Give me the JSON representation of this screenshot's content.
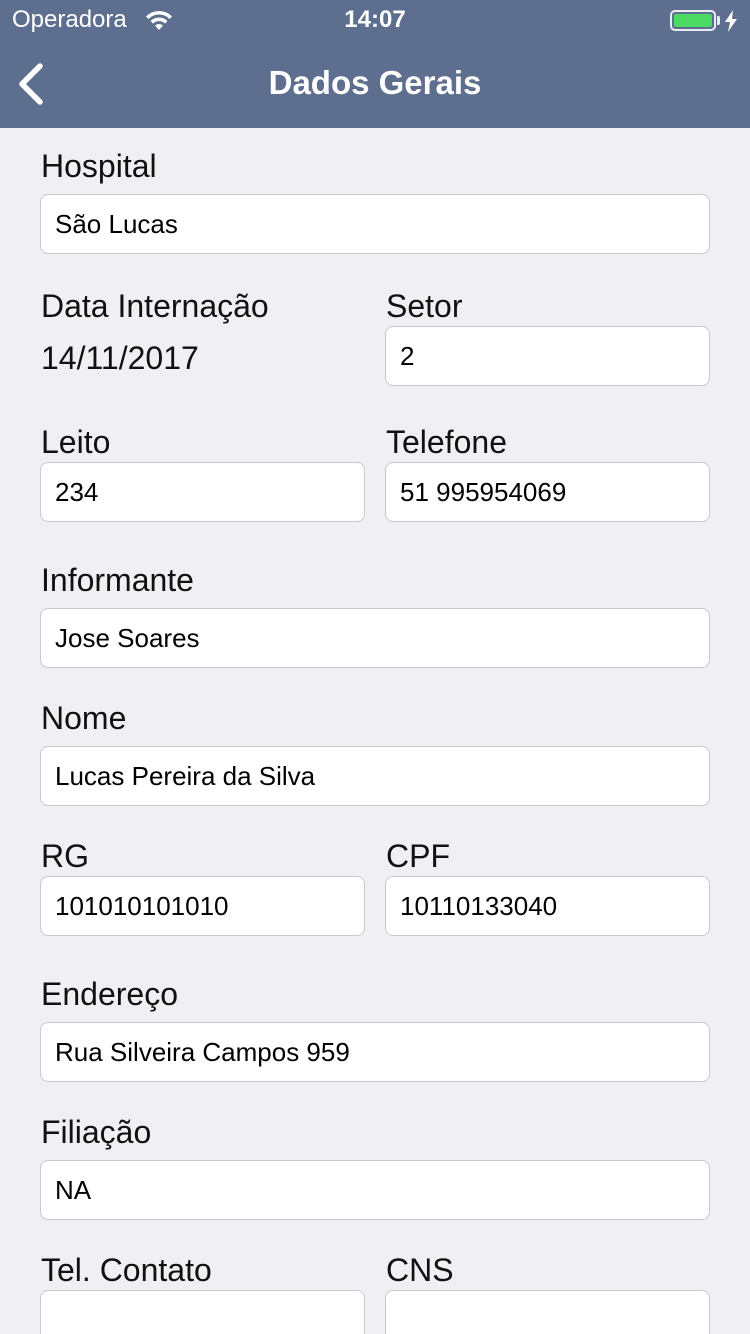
{
  "status_bar": {
    "carrier": "Operadora",
    "time": "14:07",
    "battery_level": 1.0
  },
  "nav": {
    "title": "Dados Gerais",
    "back_icon": "chevron-left-icon"
  },
  "form": {
    "hospital": {
      "label": "Hospital",
      "value": "São Lucas"
    },
    "data_internacao": {
      "label": "Data Internação",
      "value": "14/11/2017"
    },
    "setor": {
      "label": "Setor",
      "value": "2"
    },
    "leito": {
      "label": "Leito",
      "value": "234"
    },
    "telefone": {
      "label": "Telefone",
      "value": "51 995954069"
    },
    "informante": {
      "label": "Informante",
      "value": "Jose Soares"
    },
    "nome": {
      "label": "Nome",
      "value": "Lucas Pereira da Silva"
    },
    "rg": {
      "label": "RG",
      "value": "101010101010"
    },
    "cpf": {
      "label": "CPF",
      "value": "10110133040"
    },
    "endereco": {
      "label": "Endereço",
      "value": "Rua Silveira Campos 959"
    },
    "filiacao": {
      "label": "Filiação",
      "value": "NA"
    },
    "tel_contato": {
      "label": "Tel. Contato",
      "value": ""
    },
    "cns": {
      "label": "CNS",
      "value": ""
    }
  },
  "colors": {
    "nav_background": "#5e6e8e",
    "page_background": "#efeff4",
    "battery": "#4cd964"
  }
}
